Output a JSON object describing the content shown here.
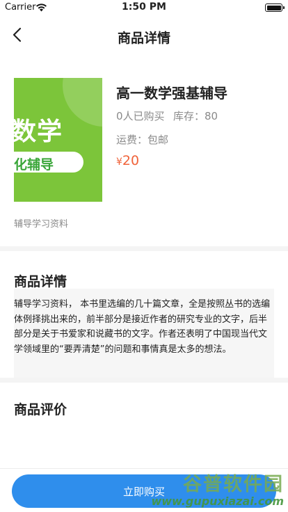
{
  "status_bar": {
    "carrier": "Carrier",
    "time": "1:50 PM"
  },
  "nav": {
    "title": "商品详情"
  },
  "product": {
    "thumbnail": {
      "text_large": "数学",
      "text_pill": "化辅导"
    },
    "name": "高一数学强基辅导",
    "sold": "0人已购买",
    "stock": "库存：80",
    "shipping": "运费：包邮",
    "price_symbol": "¥",
    "price": "20",
    "subtitle": "辅导学习资料"
  },
  "details": {
    "title": "商品详情",
    "text": "辅导学习资料，  本书里选编的几十篇文章，全是按照丛书的选编体例择挑出来的，前半部分是接近作者的研究专业的文字，后半部分是关于书爱家和说藏书的文字。作者还表明了中国现当代文学领域里的“要弄清楚”的问题和事情真是太多的想法。"
  },
  "reviews": {
    "title": "商品评价"
  },
  "bottom": {
    "buy_label": "立即购买"
  },
  "watermark": {
    "top": "谷普软件园",
    "bottom": "www.gupuxiazai.com"
  }
}
